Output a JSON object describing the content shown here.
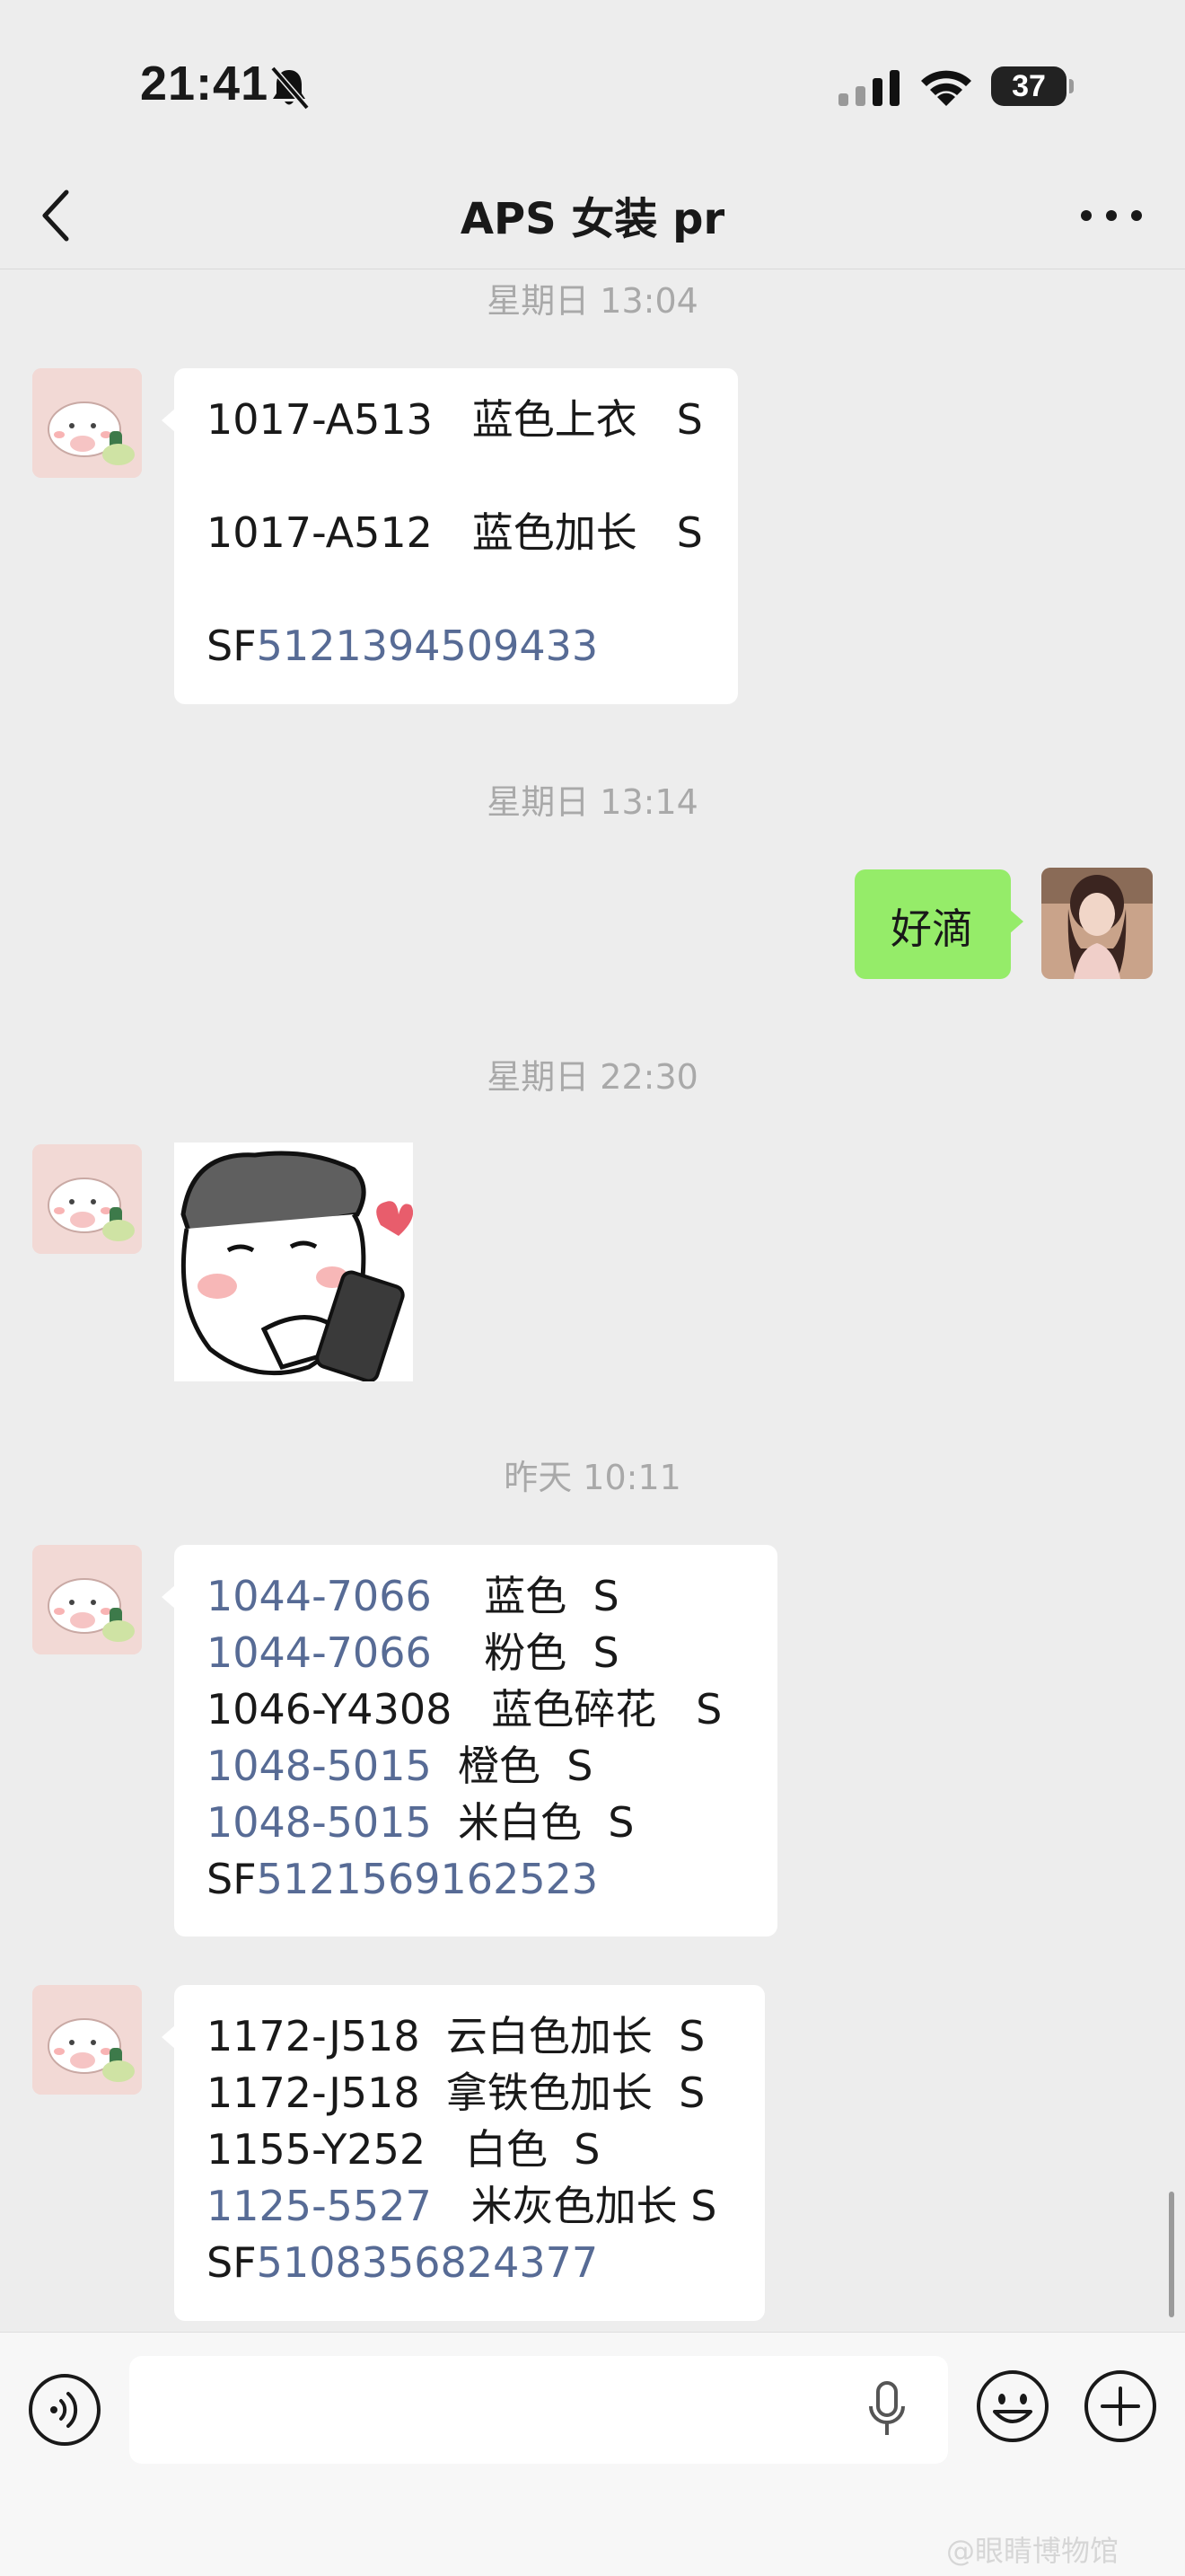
{
  "status_bar": {
    "time": "21:41",
    "battery": "37"
  },
  "nav": {
    "title": "APS 女装 pr"
  },
  "messages": {
    "ts1": "星期日 13:04",
    "m1": {
      "l1": "1017-A513   蓝色上衣   S",
      "l2": "1017-A512   蓝色加长   S",
      "l3_prefix": "SF",
      "l3_link": "5121394509433"
    },
    "ts2": "星期日 13:14",
    "m2": "好滴",
    "ts3": "星期日 22:30",
    "ts4": "昨天 10:11",
    "m4": {
      "l1_link": "1044-7066",
      "l1_text": "    蓝色  S",
      "l2_link": "1044-7066",
      "l2_text": "    粉色  S",
      "l3": "1046-Y4308   蓝色碎花   S",
      "l4_link": "1048-5015",
      "l4_text": "  橙色  S",
      "l5_link": "1048-5015",
      "l5_text": "  米白色  S",
      "l6_prefix": "SF",
      "l6_link": "5121569162523"
    },
    "m5": {
      "l1": "1172-J518  云白色加长  S",
      "l2": "1172-J518  拿铁色加长  S",
      "l3": "1155-Y252   白色  S",
      "l4_link": "1125-5527",
      "l4_text": "   米灰色加长 S",
      "l5_prefix": "SF",
      "l5_link": "5108356824377"
    }
  },
  "watermark": "@眼睛博物馆",
  "colors": {
    "background": "#ededed",
    "link": "#576b95",
    "self_bubble": "#95ec69"
  }
}
